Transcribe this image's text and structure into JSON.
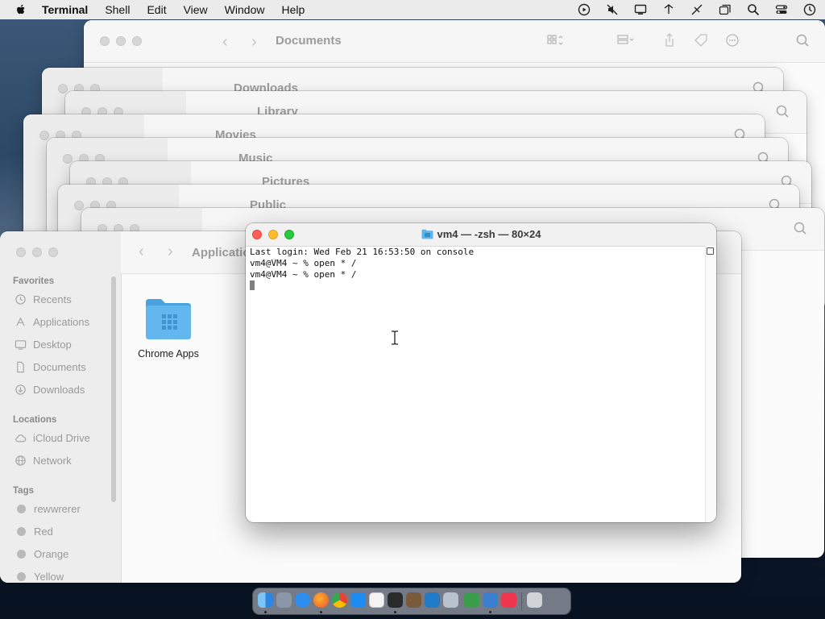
{
  "menubar": {
    "app_name": "Terminal",
    "items": [
      "Shell",
      "Edit",
      "View",
      "Window",
      "Help"
    ],
    "status_icons": [
      "screen-record-icon",
      "mute-icon",
      "display-icon",
      "wifi-icon",
      "no-network-icon",
      "window-switcher-icon",
      "spotlight-search-icon",
      "control-center-icon",
      "clock-icon"
    ]
  },
  "finder_stack": [
    {
      "title": "Documents"
    },
    {
      "title": "Downloads"
    },
    {
      "title": "Library"
    },
    {
      "title": "Movies"
    },
    {
      "title": "Music"
    },
    {
      "title": "Pictures"
    },
    {
      "title": "Public"
    }
  ],
  "applications_window": {
    "title": "Applications",
    "sidebar": {
      "favorites_heading": "Favorites",
      "favorites": [
        {
          "label": "Recents",
          "icon": "clock-icon"
        },
        {
          "label": "Applications",
          "icon": "applications-icon"
        },
        {
          "label": "Desktop",
          "icon": "desktop-icon"
        },
        {
          "label": "Documents",
          "icon": "document-icon"
        },
        {
          "label": "Downloads",
          "icon": "download-icon"
        }
      ],
      "locations_heading": "Locations",
      "locations": [
        {
          "label": "iCloud Drive",
          "icon": "cloud-icon"
        },
        {
          "label": "Network",
          "icon": "globe-icon"
        }
      ],
      "tags_heading": "Tags",
      "tags": [
        {
          "label": "rewwrerer",
          "color": "#b8b8b8"
        },
        {
          "label": "Red",
          "color": "#b8b8b8"
        },
        {
          "label": "Orange",
          "color": "#b8b8b8"
        },
        {
          "label": "Yellow",
          "color": "#b8b8b8"
        }
      ]
    },
    "content": {
      "items": [
        {
          "label": "Chrome Apps",
          "icon": "folder-icon"
        }
      ]
    }
  },
  "terminal": {
    "title": "vm4 — -zsh — 80×24",
    "lines": [
      "Last login: Wed Feb 21 16:53:50 on console",
      "vm4@VM4 ~ % open * /",
      "vm4@VM4 ~ % open * /"
    ]
  },
  "dock": {
    "apps": [
      {
        "name": "Finder",
        "color": "#3b8fe6"
      },
      {
        "name": "Launchpad",
        "color": "#8b96a8"
      },
      {
        "name": "Safari",
        "color": "#2e8ef0"
      },
      {
        "name": "Firefox",
        "color": "#e8722a"
      },
      {
        "name": "Chrome",
        "color": "#e8c12c"
      },
      {
        "name": "App Store",
        "color": "#1f8cf2"
      },
      {
        "name": "TextEdit",
        "color": "#e9e9e9"
      },
      {
        "name": "Terminal",
        "color": "#2a2a2a"
      },
      {
        "name": "Scripts",
        "color": "#7a5a3a"
      },
      {
        "name": "VS Code",
        "color": "#1f7ac8"
      },
      {
        "name": "Utility",
        "color": "#b8c2cc"
      },
      {
        "name": "Numbers",
        "color": "#3a9e4a"
      },
      {
        "name": "Preview",
        "color": "#3b7fd1"
      },
      {
        "name": "Music",
        "color": "#f0364f"
      },
      {
        "name": "Trash",
        "color": "#cfd3d8"
      }
    ]
  },
  "colors": {
    "close": "#fe5f57",
    "minimize": "#febc2e",
    "zoom": "#28c840",
    "folder": "#5ab5ec"
  }
}
